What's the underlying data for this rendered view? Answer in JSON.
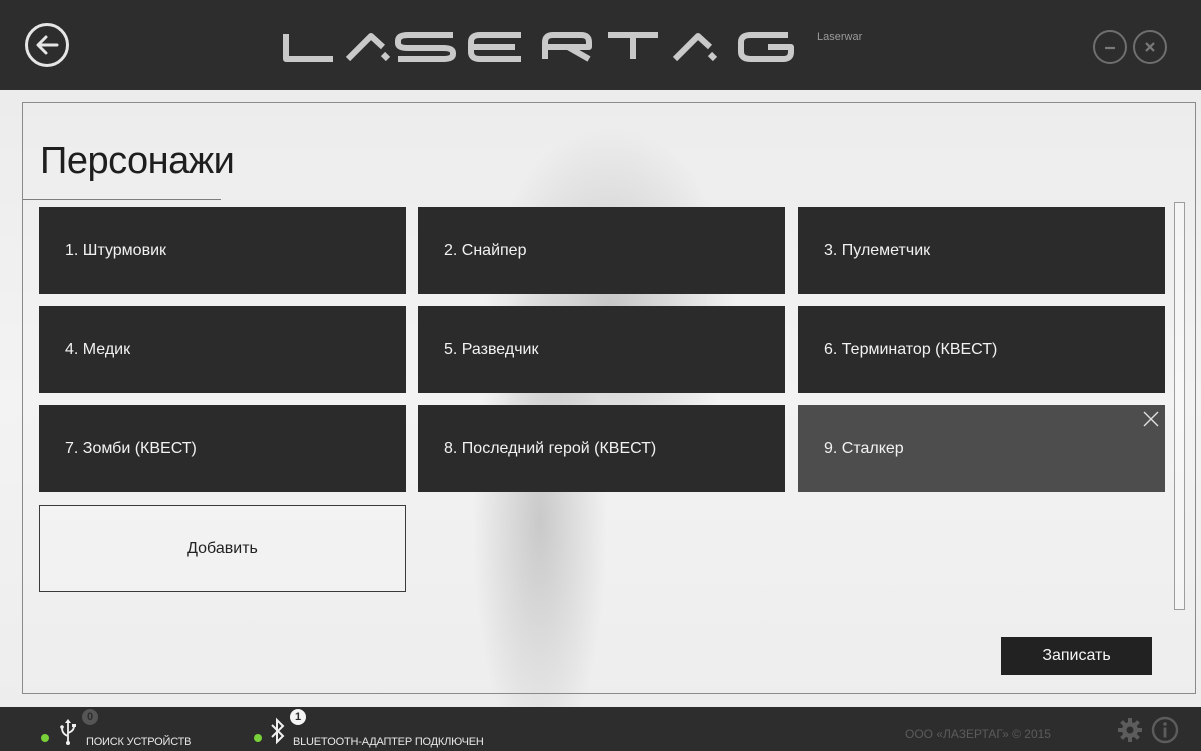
{
  "titlebar": {
    "logo_text": "LASERTAG",
    "logo_subtitle": "Laserwar"
  },
  "page": {
    "title": "Персонажи"
  },
  "characters": [
    {
      "label": "1. Штурмовик",
      "selected": false
    },
    {
      "label": "2. Снайпер",
      "selected": false
    },
    {
      "label": "3. Пулеметчик",
      "selected": false
    },
    {
      "label": "4. Медик",
      "selected": false
    },
    {
      "label": "5. Разведчик",
      "selected": false
    },
    {
      "label": "6. Терминатор (КВЕСТ)",
      "selected": false
    },
    {
      "label": "7. Зомби (КВЕСТ)",
      "selected": false
    },
    {
      "label": "8. Последний герой (КВЕСТ)",
      "selected": false
    },
    {
      "label": "9. Сталкер",
      "selected": true
    }
  ],
  "actions": {
    "add_label": "Добавить",
    "save_label": "Записать"
  },
  "statusbar": {
    "usb_badge": "0",
    "usb_text": "ПОИСК УСТРОЙСТВ",
    "bt_badge": "1",
    "bt_text": "BLUETOOTH-АДАПТЕР ПОДКЛЮЧЕН",
    "copyright": "ООО «ЛАЗЕРТАГ» © 2015"
  },
  "icons": {
    "back": "back-arrow-icon",
    "minimize": "minimize-icon",
    "close": "close-icon",
    "usb": "usb-icon",
    "bluetooth": "bluetooth-icon",
    "settings": "gear-icon",
    "info": "info-icon"
  },
  "colors": {
    "chrome": "#2d2d2d",
    "card": "#2b2b2b",
    "card_selected": "#4d4d4d",
    "status_ok": "#79d13a"
  }
}
